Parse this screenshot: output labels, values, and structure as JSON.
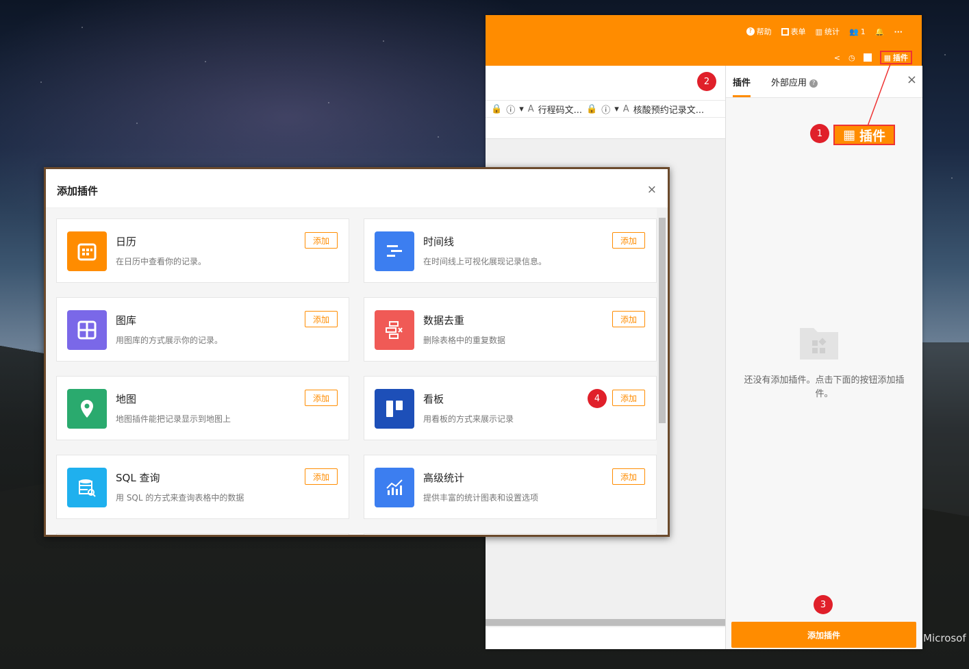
{
  "app": {
    "topbar": {
      "help": "帮助",
      "form": "表单",
      "stats": "统计",
      "members": "1",
      "more": "···",
      "plugin": "插件"
    },
    "columns": [
      "行程码文...",
      "核酸预约记录文..."
    ],
    "side": {
      "tabs": [
        "插件",
        "外部应用"
      ],
      "empty_text": "还没有添加插件。点击下面的按钮添加插件。",
      "add_button": "添加插件"
    }
  },
  "annotations": {
    "badge1": "1",
    "badge2": "2",
    "badge3": "3",
    "badge4": "4",
    "callout_label": "插件"
  },
  "modal": {
    "title": "添加插件",
    "add_label": "添加",
    "plugins": [
      {
        "name": "日历",
        "desc": "在日历中查看你的记录。",
        "color": "#ff8c00",
        "icon": "calendar-icon"
      },
      {
        "name": "时间线",
        "desc": "在时间线上可视化展现记录信息。",
        "color": "#3c7ef0",
        "icon": "timeline-icon"
      },
      {
        "name": "图库",
        "desc": "用图库的方式展示你的记录。",
        "color": "#7a68e8",
        "icon": "gallery-icon"
      },
      {
        "name": "数据去重",
        "desc": "删除表格中的重复数据",
        "color": "#f05a56",
        "icon": "dedupe-icon"
      },
      {
        "name": "地图",
        "desc": "地图插件能把记录显示到地图上",
        "color": "#2aaa6e",
        "icon": "map-pin-icon"
      },
      {
        "name": "看板",
        "desc": "用看板的方式来展示记录",
        "color": "#1d4fb8",
        "icon": "kanban-icon"
      },
      {
        "name": "SQL 查询",
        "desc": "用 SQL 的方式来查询表格中的数据",
        "color": "#1fb0ee",
        "icon": "sql-query-icon"
      },
      {
        "name": "高级统计",
        "desc": "提供丰富的统计图表和设置选项",
        "color": "#3c7ef0",
        "icon": "advanced-stats-icon"
      }
    ]
  },
  "desktop": {
    "microsoft_text": "Microsof"
  }
}
